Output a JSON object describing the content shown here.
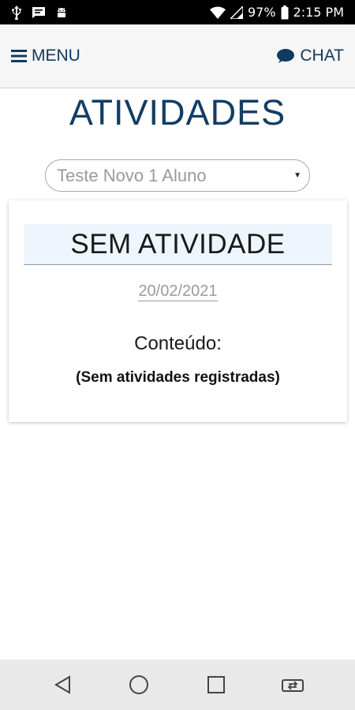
{
  "status_bar": {
    "battery": "97%",
    "time": "2:15 PM",
    "icons": [
      "usb-icon",
      "message-icon",
      "android-icon",
      "wifi-icon",
      "signal-icon",
      "battery-icon"
    ]
  },
  "header": {
    "menu_label": "MENU",
    "chat_label": "CHAT",
    "accent_color": "#103a60"
  },
  "page": {
    "title": "ATIVIDADES"
  },
  "student_select": {
    "selected": "Teste Novo 1 Aluno"
  },
  "activity_card": {
    "title": "SEM ATIVIDADE",
    "date": "20/02/2021",
    "content_label": "Conteúdo:",
    "content_text": "(Sem atividades registradas)"
  },
  "system_nav": {
    "buttons": [
      "back-icon",
      "home-icon",
      "recents-icon",
      "screen-rotate-icon"
    ]
  }
}
